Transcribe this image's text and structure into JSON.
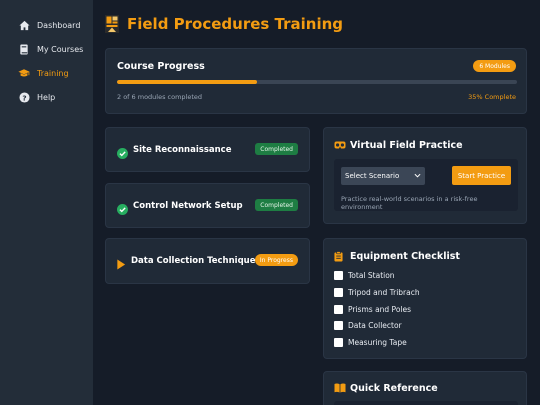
{
  "sidebar": {
    "items": [
      {
        "label": "Dashboard",
        "icon": "home-icon"
      },
      {
        "label": "My Courses",
        "icon": "book-icon"
      },
      {
        "label": "Training",
        "icon": "graduation-cap-icon"
      },
      {
        "label": "Help",
        "icon": "question-circle-icon"
      }
    ]
  },
  "header": {
    "title": "Field Procedures Training",
    "logo": "field-logo-icon"
  },
  "progress": {
    "title": "Course Progress",
    "badge": "6 Modules",
    "completed_text": "2 of 6 modules completed",
    "percent_text": "35% Complete",
    "percent": 35
  },
  "modules": [
    {
      "title": "Site Reconnaissance",
      "status": "Completed",
      "icon": "check-circle-icon"
    },
    {
      "title": "Control Network Setup",
      "status": "Completed",
      "icon": "check-circle-icon"
    },
    {
      "title": "Data Collection Techniques",
      "status": "In Progress",
      "icon": "play-icon"
    }
  ],
  "virtual_practice": {
    "title": "Virtual Field Practice",
    "select_value": "Select Scenario",
    "start_label": "Start Practice",
    "description": "Practice real-world scenarios in a risk-free environment"
  },
  "equipment": {
    "title": "Equipment Checklist",
    "items": [
      "Total Station",
      "Tripod and Tribrach",
      "Prisms and Poles",
      "Data Collector",
      "Measuring Tape"
    ]
  },
  "quick_reference": {
    "title": "Quick Reference"
  },
  "colors": {
    "accent": "#f39c12",
    "success": "#1e7d43",
    "background": "#151c28",
    "card": "#202a37"
  }
}
